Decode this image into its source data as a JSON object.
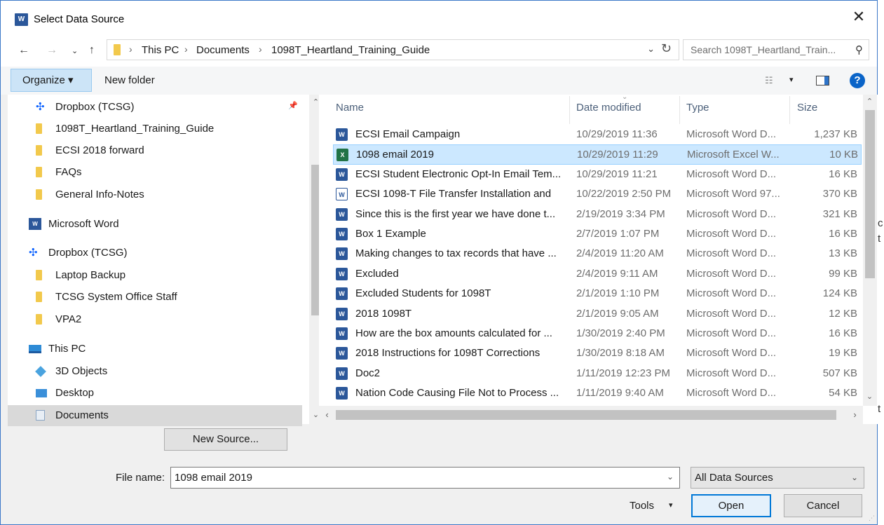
{
  "window": {
    "title": "Select Data Source",
    "app_icon": "word-icon",
    "close_glyph": "✕"
  },
  "address": {
    "crumbs": [
      "This PC",
      "Documents",
      "1098T_Heartland_Training_Guide"
    ],
    "search_placeholder": "Search 1098T_Heartland_Train..."
  },
  "toolbar": {
    "organize_label": "Organize ▾",
    "new_folder_label": "New folder"
  },
  "nav": {
    "items": [
      {
        "label": "Dropbox (TCSG)",
        "icon": "dropbox-folder-icon"
      },
      {
        "label": "1098T_Heartland_Training_Guide",
        "icon": "folder-icon"
      },
      {
        "label": "ECSI 2018 forward",
        "icon": "folder-icon"
      },
      {
        "label": "FAQs",
        "icon": "folder-icon"
      },
      {
        "label": "General Info-Notes",
        "icon": "folder-icon"
      },
      {
        "label": "Microsoft Word",
        "icon": "word-icon"
      },
      {
        "label": "Dropbox (TCSG)",
        "icon": "dropbox-icon"
      },
      {
        "label": "Laptop  Backup",
        "icon": "folder-icon"
      },
      {
        "label": "TCSG System Office Staff",
        "icon": "shared-folder-icon"
      },
      {
        "label": "VPA2",
        "icon": "shared-folder-icon"
      },
      {
        "label": "This PC",
        "icon": "computer-icon"
      },
      {
        "label": "3D Objects",
        "icon": "3d-objects-icon"
      },
      {
        "label": "Desktop",
        "icon": "desktop-icon"
      },
      {
        "label": "Documents",
        "icon": "documents-icon"
      }
    ],
    "selected_label": "Documents"
  },
  "files": {
    "columns": {
      "name": "Name",
      "date": "Date modified",
      "type": "Type",
      "size": "Size"
    },
    "rows": [
      {
        "name": "ECSI Email Campaign",
        "date": "10/29/2019 11:36",
        "type": "Microsoft Word D...",
        "size": "1,237 KB",
        "icon": "word-doc-icon"
      },
      {
        "name": "1098 email 2019",
        "date": "10/29/2019 11:29",
        "type": "Microsoft Excel W...",
        "size": "10 KB",
        "icon": "excel-workbook-icon"
      },
      {
        "name": "ECSI Student Electronic Opt-In Email Tem...",
        "date": "10/29/2019 11:21",
        "type": "Microsoft Word D...",
        "size": "16 KB",
        "icon": "word-doc-icon"
      },
      {
        "name": "ECSI 1098-T File Transfer Installation and",
        "date": "10/22/2019 2:50 PM",
        "type": "Microsoft Word 97...",
        "size": "370 KB",
        "icon": "word97-doc-icon"
      },
      {
        "name": "Since this is the first year we have done t...",
        "date": "2/19/2019 3:34 PM",
        "type": "Microsoft Word D...",
        "size": "321 KB",
        "icon": "word-doc-icon"
      },
      {
        "name": "Box 1 Example",
        "date": "2/7/2019 1:07 PM",
        "type": "Microsoft Word D...",
        "size": "16 KB",
        "icon": "word-doc-icon"
      },
      {
        "name": "Making changes to tax records that have ...",
        "date": "2/4/2019 11:20 AM",
        "type": "Microsoft Word D...",
        "size": "13 KB",
        "icon": "word-doc-icon"
      },
      {
        "name": "Excluded",
        "date": "2/4/2019 9:11 AM",
        "type": "Microsoft Word D...",
        "size": "99 KB",
        "icon": "word-doc-icon"
      },
      {
        "name": "Excluded Students for 1098T",
        "date": "2/1/2019 1:10 PM",
        "type": "Microsoft Word D...",
        "size": "124 KB",
        "icon": "word-doc-icon"
      },
      {
        "name": "2018 1098T",
        "date": "2/1/2019 9:05 AM",
        "type": "Microsoft Word D...",
        "size": "12 KB",
        "icon": "word-doc-icon"
      },
      {
        "name": "How are the box amounts calculated for ...",
        "date": "1/30/2019 2:40 PM",
        "type": "Microsoft Word D...",
        "size": "16 KB",
        "icon": "word-doc-icon"
      },
      {
        "name": "2018 Instructions for 1098T Corrections",
        "date": "1/30/2019 8:18 AM",
        "type": "Microsoft Word D...",
        "size": "19 KB",
        "icon": "word-doc-icon"
      },
      {
        "name": "Doc2",
        "date": "1/11/2019 12:23 PM",
        "type": "Microsoft Word D...",
        "size": "507 KB",
        "icon": "word-doc-icon"
      },
      {
        "name": "Nation Code Causing File Not to Process ...",
        "date": "1/11/2019 9:40 AM",
        "type": "Microsoft Word D...",
        "size": "54 KB",
        "icon": "word-doc-icon"
      }
    ],
    "selected_name": "1098 email 2019"
  },
  "bottom": {
    "new_source_label": "New Source...",
    "file_name_label": "File name:",
    "file_name_value": "1098 email 2019",
    "filter_value": "All Data Sources",
    "tools_label": "Tools",
    "open_label": "Open",
    "cancel_label": "Cancel"
  },
  "background_fragments": [
    "c",
    "t",
    "t"
  ],
  "colors": {
    "accent": "#0078d7",
    "selection": "#cce8ff",
    "word": "#2b579a",
    "excel": "#217346"
  }
}
